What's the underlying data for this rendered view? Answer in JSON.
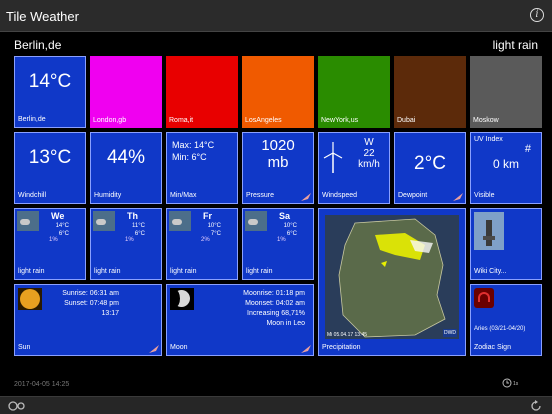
{
  "app": {
    "title": "Tile Weather",
    "info_label": "i"
  },
  "header": {
    "location": "Berlin,de",
    "condition": "light rain"
  },
  "row1": [
    {
      "name": "tile-berlin",
      "value": "14°C",
      "label": "Berlin,de",
      "color": "#1038c8"
    },
    {
      "name": "tile-london",
      "value": "",
      "label": "London,gb",
      "color": "#f000f0"
    },
    {
      "name": "tile-roma",
      "value": "",
      "label": "Roma,it",
      "color": "#e80000"
    },
    {
      "name": "tile-losangeles",
      "value": "",
      "label": "LosAngeles",
      "color": "#f05a00"
    },
    {
      "name": "tile-newyork",
      "value": "",
      "label": "NewYork,us",
      "color": "#2a8c00"
    },
    {
      "name": "tile-dubai",
      "value": "",
      "label": "Dubai",
      "color": "#5c2a0a"
    },
    {
      "name": "tile-moskow",
      "value": "",
      "label": "Moskow",
      "color": "#5a5a5a"
    }
  ],
  "row2": {
    "windchill": {
      "value": "13°C",
      "label": "Windchill"
    },
    "humidity": {
      "value": "44%",
      "label": "Humidity"
    },
    "minmax": {
      "max": "Max: 14°C",
      "min": "Min: 6°C",
      "label": "Min/Max"
    },
    "pressure": {
      "value": "1020",
      "unit": "mb",
      "label": "Pressure"
    },
    "windspeed": {
      "dir": "W",
      "speed": "22",
      "unit": "km/h",
      "label": "Windspeed"
    },
    "dewpoint": {
      "value": "2°C",
      "label": "Dewpoint"
    },
    "visible": {
      "uv_label": "UV Index",
      "uv_value": "#",
      "value": "0 km",
      "label": "Visible"
    }
  },
  "forecast": [
    {
      "day": "We",
      "hi": "14°C",
      "lo": "6°C",
      "precip": "1%",
      "label": "light rain"
    },
    {
      "day": "Th",
      "hi": "11°C",
      "lo": "6°C",
      "precip": "1%",
      "label": "light rain"
    },
    {
      "day": "Fr",
      "hi": "10°C",
      "lo": "7°C",
      "precip": "2%",
      "label": "light rain"
    },
    {
      "day": "Sa",
      "hi": "10°C",
      "lo": "6°C",
      "precip": "1%",
      "label": "light rain"
    }
  ],
  "precipitation": {
    "label": "Precipitation",
    "timestamp": "Mi 05.04.17 13:45",
    "brand": "DWD"
  },
  "wiki": {
    "label": "Wiki City..."
  },
  "sun": {
    "sunrise": "Sunrise: 06:31 am",
    "sunset": "Sunset: 07:48 pm",
    "duration": "13:17",
    "label": "Sun"
  },
  "moon": {
    "moonrise": "Moonrise: 01:18 pm",
    "moonset": "Moonset: 04:02 am",
    "phase": "Increasing  68,71%",
    "sign": "Moon in Leo",
    "label": "Moon"
  },
  "zodiac": {
    "label": "Aries (03/21-04/20)",
    "sub": "Zodiac Sign"
  },
  "footer": {
    "timestamp": "2017-04-05 14:25",
    "clock_label": "1s"
  }
}
